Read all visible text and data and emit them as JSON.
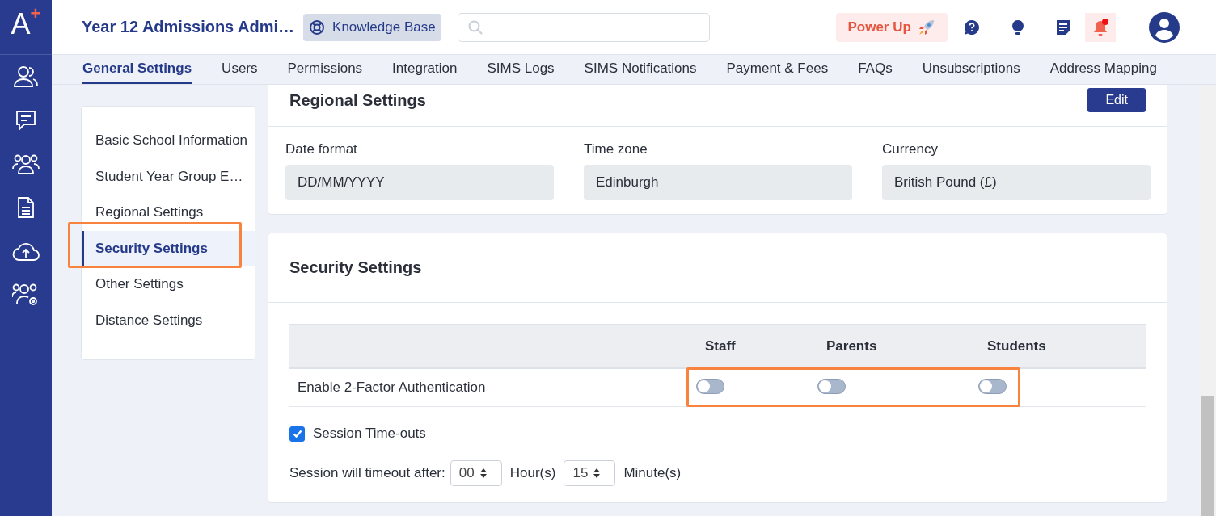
{
  "logo": {
    "letter": "A",
    "mark": "+"
  },
  "header": {
    "title": "Year 12 Admissions Admi…",
    "knowledge_base": "Knowledge Base",
    "power_up": "Power Up",
    "notification_unread": true
  },
  "sidebar": {
    "items": [
      {
        "kind": "people"
      },
      {
        "kind": "chat"
      },
      {
        "kind": "group"
      },
      {
        "kind": "document"
      },
      {
        "kind": "upload"
      },
      {
        "kind": "group-settings"
      }
    ]
  },
  "tabs": [
    {
      "label": "General Settings",
      "selected": true
    },
    {
      "label": "Users",
      "selected": false
    },
    {
      "label": "Permissions",
      "selected": false
    },
    {
      "label": "Integration",
      "selected": false
    },
    {
      "label": "SIMS Logs",
      "selected": false
    },
    {
      "label": "SIMS Notifications",
      "selected": false
    },
    {
      "label": "Payment & Fees",
      "selected": false
    },
    {
      "label": "FAQs",
      "selected": false
    },
    {
      "label": "Unsubscriptions",
      "selected": false
    },
    {
      "label": "Address Mapping",
      "selected": false
    }
  ],
  "settings_nav": [
    {
      "label": "Basic School Information",
      "selected": false,
      "highlighted": false
    },
    {
      "label": "Student Year Group E…",
      "selected": false,
      "highlighted": false
    },
    {
      "label": "Regional Settings",
      "selected": false,
      "highlighted": false
    },
    {
      "label": "Security Settings",
      "selected": true,
      "highlighted": true
    },
    {
      "label": "Other Settings",
      "selected": false,
      "highlighted": false
    },
    {
      "label": "Distance Settings",
      "selected": false,
      "highlighted": false
    }
  ],
  "regional": {
    "title": "Regional Settings",
    "edit": "Edit",
    "fields": [
      {
        "label": "Date format",
        "value": "DD/MM/YYYY"
      },
      {
        "label": "Time zone",
        "value": "Edinburgh"
      },
      {
        "label": "Currency",
        "value": "British Pound (£)"
      }
    ]
  },
  "security": {
    "title": "Security Settings",
    "table": {
      "columns": [
        "Staff",
        "Parents",
        "Students"
      ],
      "rows": [
        {
          "label": "Enable 2-Factor Authentication",
          "toggles": [
            {
              "on": false
            },
            {
              "on": false
            },
            {
              "on": false
            }
          ],
          "highlighted": true
        }
      ]
    },
    "session_timeouts": {
      "label": "Session Time-outs",
      "checked": true
    },
    "timeout": {
      "label": "Session will timeout after:",
      "hours": "00",
      "hours_unit": "Hour(s)",
      "minutes": "15",
      "minutes_unit": "Minute(s)"
    }
  }
}
